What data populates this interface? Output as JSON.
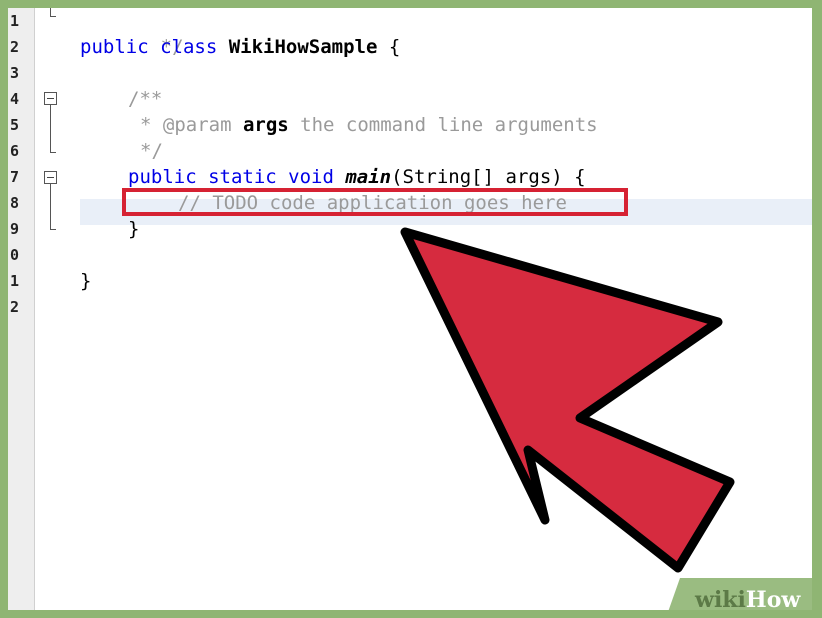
{
  "editor": {
    "line_numbers": [
      "1",
      "2",
      "3",
      "4",
      "5",
      "6",
      "7",
      "8",
      "9",
      "0",
      "1",
      "2"
    ],
    "lines": {
      "l1_comment_end": "*/",
      "l2_kw": "public class ",
      "l2_class": "WikiHowSample",
      "l2_brace": " {",
      "l4_doc_open": "/**",
      "l5_star": "* ",
      "l5_tag": "@param ",
      "l5_arg": "args",
      "l5_desc": " the command line arguments",
      "l6_doc_close": "*/",
      "l7_kw": "public static void ",
      "l7_method": "main",
      "l7_params": "(String[] args) {",
      "l8_todo": "// TODO code application goes here",
      "l9_brace": "}",
      "l11_brace": "}"
    }
  },
  "watermark": {
    "wiki": "wiki",
    "how": "How"
  },
  "colors": {
    "keyword": "#0000e6",
    "comment": "#9a9a9a",
    "highlight": "#d62233",
    "arrow_fill": "#d62b3f",
    "border": "#8fb573"
  },
  "icons": [
    "fold-collapse-icon",
    "pointer-arrow-icon"
  ]
}
